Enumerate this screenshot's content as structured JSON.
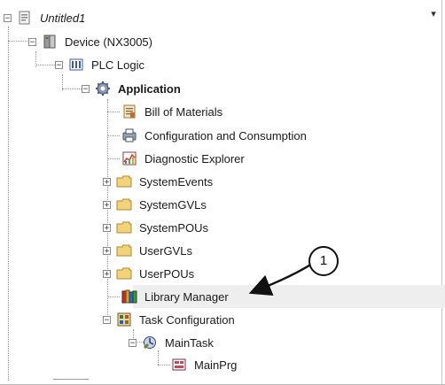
{
  "dropdown_glyph": "▾",
  "tree": {
    "root": {
      "label": "Untitled1",
      "toggle": "−",
      "icon": "project-icon"
    },
    "device": {
      "label": "Device (NX3005)",
      "toggle": "−",
      "icon": "device-icon"
    },
    "plc_logic": {
      "label": "PLC Logic",
      "toggle": "−",
      "icon": "plc-logic-icon"
    },
    "application": {
      "label": "Application",
      "toggle": "−",
      "icon": "application-gear-icon"
    },
    "bill_of_materials": {
      "label": "Bill of Materials",
      "icon": "document-icon"
    },
    "configuration": {
      "label": "Configuration and Consumption",
      "icon": "printer-icon"
    },
    "diagnostic": {
      "label": "Diagnostic Explorer",
      "icon": "chart-icon"
    },
    "system_events": {
      "label": "SystemEvents",
      "toggle": "+",
      "icon": "folder-icon"
    },
    "system_gvls": {
      "label": "SystemGVLs",
      "toggle": "+",
      "icon": "folder-icon"
    },
    "system_pous": {
      "label": "SystemPOUs",
      "toggle": "+",
      "icon": "folder-icon"
    },
    "user_gvls": {
      "label": "UserGVLs",
      "toggle": "+",
      "icon": "folder-icon"
    },
    "user_pous": {
      "label": "UserPOUs",
      "toggle": "+",
      "icon": "folder-icon"
    },
    "library_manager": {
      "label": "Library Manager",
      "icon": "library-books-icon"
    },
    "task_configuration": {
      "label": "Task Configuration",
      "toggle": "−",
      "icon": "task-config-icon"
    },
    "main_task": {
      "label": "MainTask",
      "toggle": "−",
      "icon": "task-icon"
    },
    "main_prg": {
      "label": "MainPrg",
      "icon": "program-icon"
    }
  },
  "callout": {
    "number": "1"
  }
}
